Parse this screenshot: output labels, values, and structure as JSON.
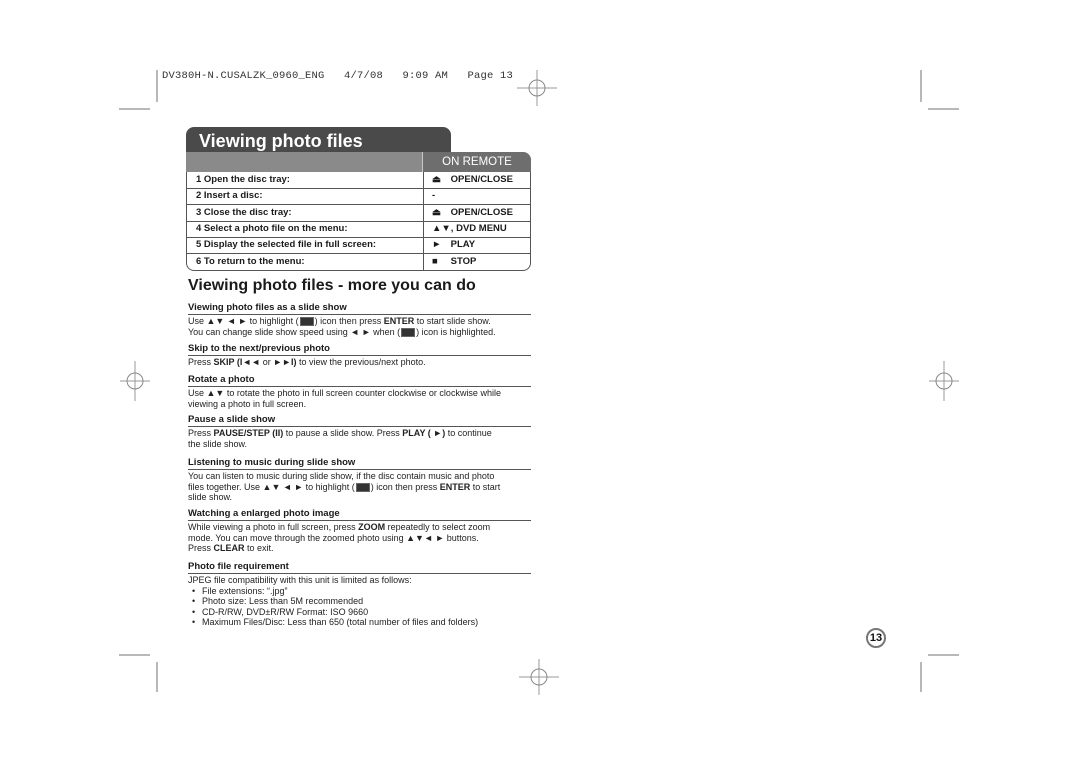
{
  "slug": "DV380H-N.CUSALZK_0960_ENG   4/7/08   9:09 AM   Page 13",
  "title": "Viewing photo files",
  "table": {
    "header_remote": "ON REMOTE",
    "rows": [
      {
        "step": "1  Open the disc tray:",
        "icon": "eject-icon",
        "glyph": "⏏",
        "key": "OPEN/CLOSE"
      },
      {
        "step": "2  Insert a disc:",
        "icon": "",
        "glyph": "",
        "key": "-"
      },
      {
        "step": "3  Close the disc tray:",
        "icon": "eject-icon",
        "glyph": "⏏",
        "key": "OPEN/CLOSE"
      },
      {
        "step": "4  Select a photo file on the menu:",
        "icon": "up-down-arrows-icon",
        "glyph": "",
        "key": "▲▼, DVD MENU"
      },
      {
        "step": "5  Display the selected file in full screen:",
        "icon": "play-icon",
        "glyph": "►",
        "key": "PLAY"
      },
      {
        "step": "6  To return to the menu:",
        "icon": "stop-icon",
        "glyph": "■",
        "key": "STOP"
      }
    ]
  },
  "subtitle": "Viewing photo files - more you can do",
  "sections": [
    {
      "heading": "Viewing photo files as a slide show",
      "lines": [
        [
          "Use ▲▼ ◄ ► to highlight (",
          {
            "icon": "slideshow-icon"
          },
          ") icon then press ",
          {
            "b": "ENTER"
          },
          " to start slide show."
        ],
        [
          "You can change slide show speed using ◄ ► when (",
          {
            "icon": "speed-icon"
          },
          ") icon is highlighted."
        ]
      ]
    },
    {
      "heading": "Skip to the next/previous photo",
      "lines": [
        [
          "Press ",
          {
            "b": "SKIP (I◄◄"
          },
          " or ",
          {
            "b": "►►I)"
          },
          " to view the previous/next photo."
        ]
      ]
    },
    {
      "heading": "Rotate a photo",
      "lines": [
        [
          "Use ▲▼ to rotate the photo in full screen counter clockwise or clockwise while"
        ],
        [
          "viewing a photo in full screen."
        ]
      ]
    },
    {
      "heading": "Pause a slide show",
      "lines": [
        [
          "Press ",
          {
            "b": "PAUSE/STEP (II)"
          },
          " to pause a slide show. Press ",
          {
            "b": "PLAY ( ►)"
          },
          " to continue"
        ],
        [
          "the slide show."
        ]
      ]
    },
    {
      "heading": "Listening to music during slide show",
      "lines": [
        [
          "You can listen to music during slide show, if the disc contain music and photo"
        ],
        [
          "files together. Use ▲▼ ◄ ► to highlight (",
          {
            "icon": "music-slideshow-icon"
          },
          ") icon then press ",
          {
            "b": "ENTER"
          },
          " to start"
        ],
        [
          "slide show."
        ]
      ]
    },
    {
      "heading": "Watching a enlarged photo image",
      "lines": [
        [
          "While viewing a photo in full screen, press ",
          {
            "b": "ZOOM"
          },
          " repeatedly to select zoom"
        ],
        [
          "mode. You can move through the zoomed photo using ▲▼◄ ► buttons."
        ],
        [
          "Press ",
          {
            "b": "CLEAR"
          },
          " to exit."
        ]
      ]
    },
    {
      "heading": "Photo file requirement",
      "intro": "JPEG file compatibility with this unit is limited as follows:",
      "bullets": [
        "File extensions: “.jpg”",
        "Photo size: Less than 5M recommended",
        "CD-R/RW, DVD±R/RW Format: ISO 9660",
        "Maximum Files/Disc: Less than 650 (total number of files and folders)"
      ]
    }
  ],
  "page_number": "13"
}
